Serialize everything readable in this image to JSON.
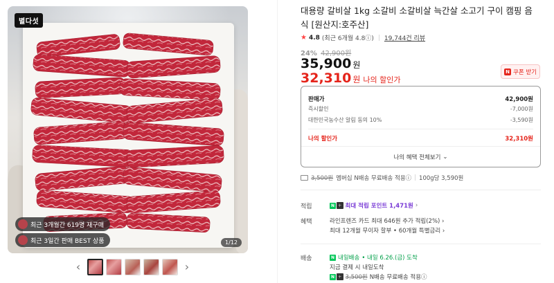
{
  "image": {
    "badge": "별다섯",
    "pill_1": "최근 3개월간 619명 재구매",
    "pill_2": "최근 3일간 판매 BEST 상품",
    "counter": "1/12"
  },
  "thumbnails": {
    "prev": "‹",
    "next": "›"
  },
  "product": {
    "title": "대용량 갈비살 1kg 소갈비 소갈비살 늑간살 소고기 구이 캠핑 음식 [원산지:호주산]",
    "rating_value": "4.8",
    "rating_recent": "(최근 6개월 4.8ⓘ)",
    "review_count": "19,744건 리뷰",
    "discount_rate": "24%",
    "original_price": "42,900원",
    "price": "35,900",
    "currency": "원",
    "my_price": "32,310",
    "my_price_label": "나의 할인가",
    "coupon_label": "쿠폰 받기"
  },
  "price_breakdown": {
    "rows": [
      {
        "label": "판매가",
        "value": "42,900원"
      },
      {
        "label": "즉시할인",
        "value": "-7,000원"
      },
      {
        "label": "대한민국농수산 알림 동의 10%",
        "value": "-3,590원"
      }
    ],
    "total_label": "나의 할인가",
    "total_value": "32,310원",
    "view_all": "나의 혜택 전체보기",
    "view_all_chevron": "⌄"
  },
  "shipping_summary": {
    "old_fee": "3,500원",
    "text": "멤버십 N배송 무료배송 적용ⓘ",
    "unit_price": "100g당 3,590원"
  },
  "benefits": {
    "points_label": "적립",
    "points_text": "최대 적립 포인트 1,471원",
    "card_label": "혜택",
    "card_line_1": "라인프렌즈 카드 최대 646원 추가 적립(2%) ›",
    "card_line_2": "최대 12개월 무이자 할부 • 60개월 특별금리 ›"
  },
  "delivery": {
    "label": "배송",
    "tag": "내일배송",
    "date": "• 내일 6.26.(금) 도착",
    "line_2": "지금 결제 시 내일도착",
    "old_fee": "3,500원",
    "line_3": "N배송 무료배송 적용ⓘ"
  },
  "colors": {
    "accent_red": "#e5241b",
    "naver_green": "#03c75a",
    "points_purple": "#7a3cd6"
  }
}
